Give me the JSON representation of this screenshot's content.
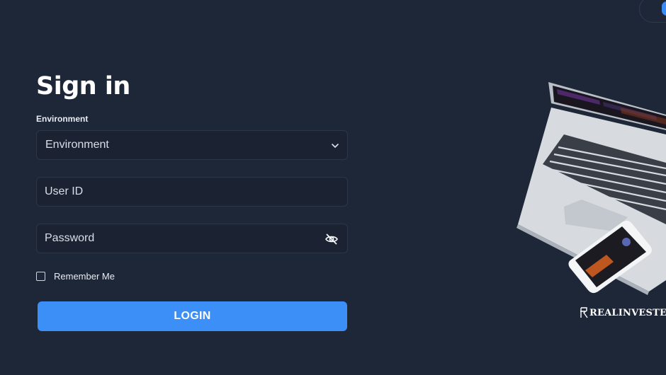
{
  "page": {
    "title": "Sign in"
  },
  "form": {
    "environment_label": "Environment",
    "environment_value": "Environment",
    "user_id_placeholder": "User ID",
    "password_placeholder": "Password",
    "remember_label": "Remember Me",
    "login_label": "LOGIN"
  },
  "brand": {
    "name": "REALINVESTER"
  },
  "icons": [
    "chevron-down-icon",
    "eye-off-icon",
    "logo-icon"
  ],
  "colors": {
    "background": "#1e2738",
    "accent": "#3b8ff6",
    "field_border": "#2c3648"
  }
}
